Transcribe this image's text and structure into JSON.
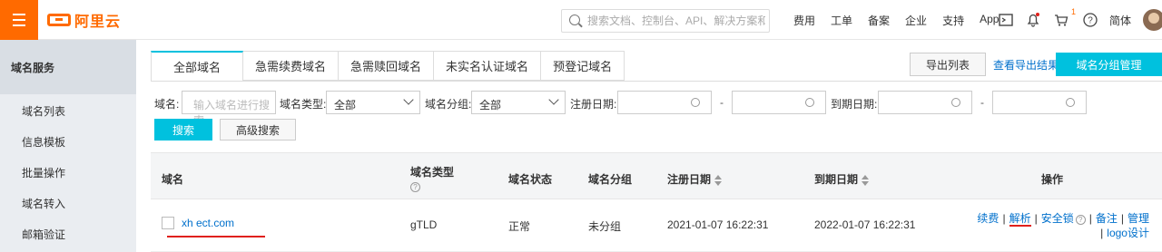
{
  "topbar": {
    "logo_text": "阿里云",
    "search_placeholder": "搜索文档、控制台、API、解决方案和资源",
    "links": [
      "费用",
      "工单",
      "备案",
      "企业",
      "支持",
      "App"
    ],
    "cart_badge": "1",
    "language": "简体",
    "brand_color": "#ff6a00"
  },
  "sidebar": {
    "title": "域名服务",
    "items": [
      "域名列表",
      "信息模板",
      "批量操作",
      "域名转入",
      "邮箱验证"
    ]
  },
  "tabs": [
    "全部域名",
    "急需续费域名",
    "急需赎回域名",
    "未实名认证域名",
    "预登记域名"
  ],
  "actions": {
    "export_list": "导出列表",
    "view_export": "查看导出结果",
    "group_manage": "域名分组管理"
  },
  "filters": {
    "domain_label": "域名:",
    "domain_placeholder": "输入域名进行搜索",
    "type_label": "域名类型:",
    "type_value": "全部",
    "group_label": "域名分组:",
    "group_value": "全部",
    "reg_date_label": "注册日期:",
    "exp_date_label": "到期日期:",
    "range_sep": "-",
    "search_btn": "搜索",
    "advanced_btn": "高级搜索"
  },
  "table": {
    "headers": {
      "domain": "域名",
      "type": "域名类型",
      "status": "域名状态",
      "group": "域名分组",
      "reg_date": "注册日期",
      "exp_date": "到期日期",
      "ops": "操作"
    },
    "rows": [
      {
        "domain": "xh     ect.com",
        "type": "gTLD",
        "status": "正常",
        "group": "未分组",
        "reg_date": "2021-01-07 16:22:31",
        "exp_date": "2022-01-07 16:22:31"
      }
    ],
    "ops": [
      "续费",
      "解析",
      "安全锁",
      "备注",
      "管理",
      "logo设计"
    ]
  },
  "accent_color": "#00c1de",
  "link_color": "#0070cc",
  "highlight_color": "#e0201b"
}
